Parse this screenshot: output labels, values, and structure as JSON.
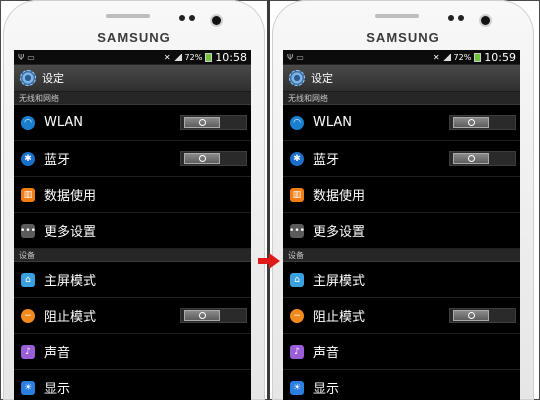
{
  "brand": "SAMSUNG",
  "screens": [
    {
      "status": {
        "percent": "72%",
        "time": "10:58"
      },
      "title": "设定",
      "sections": {
        "wireless": "无线和网络",
        "device": "设备"
      },
      "items": {
        "wlan": "WLAN",
        "bluetooth": "蓝牙",
        "data_usage": "数据使用",
        "more_settings": "更多设置",
        "home_mode": "主屏模式",
        "block_mode": "阻止模式",
        "sound": "声音",
        "display": "显示"
      }
    },
    {
      "status": {
        "percent": "72%",
        "time": "10:59"
      },
      "title": "设定",
      "sections": {
        "wireless": "无线和网络",
        "device": "设备"
      },
      "items": {
        "wlan": "WLAN",
        "bluetooth": "蓝牙",
        "data_usage": "数据使用",
        "more_settings": "更多设置",
        "home_mode": "主屏模式",
        "block_mode": "阻止模式",
        "sound": "声音",
        "display": "显示"
      }
    }
  ],
  "colors": {
    "arrow": "#e01818",
    "titlebar": "#3a3a3a",
    "screen_bg": "#000000"
  },
  "icons": [
    "usb-icon",
    "signal-icon",
    "battery-icon",
    "settings-gear-icon",
    "wifi-icon",
    "bluetooth-icon",
    "data-usage-icon",
    "more-dots-icon",
    "home-icon",
    "block-icon",
    "sound-icon",
    "display-icon",
    "arrow-right-icon"
  ]
}
